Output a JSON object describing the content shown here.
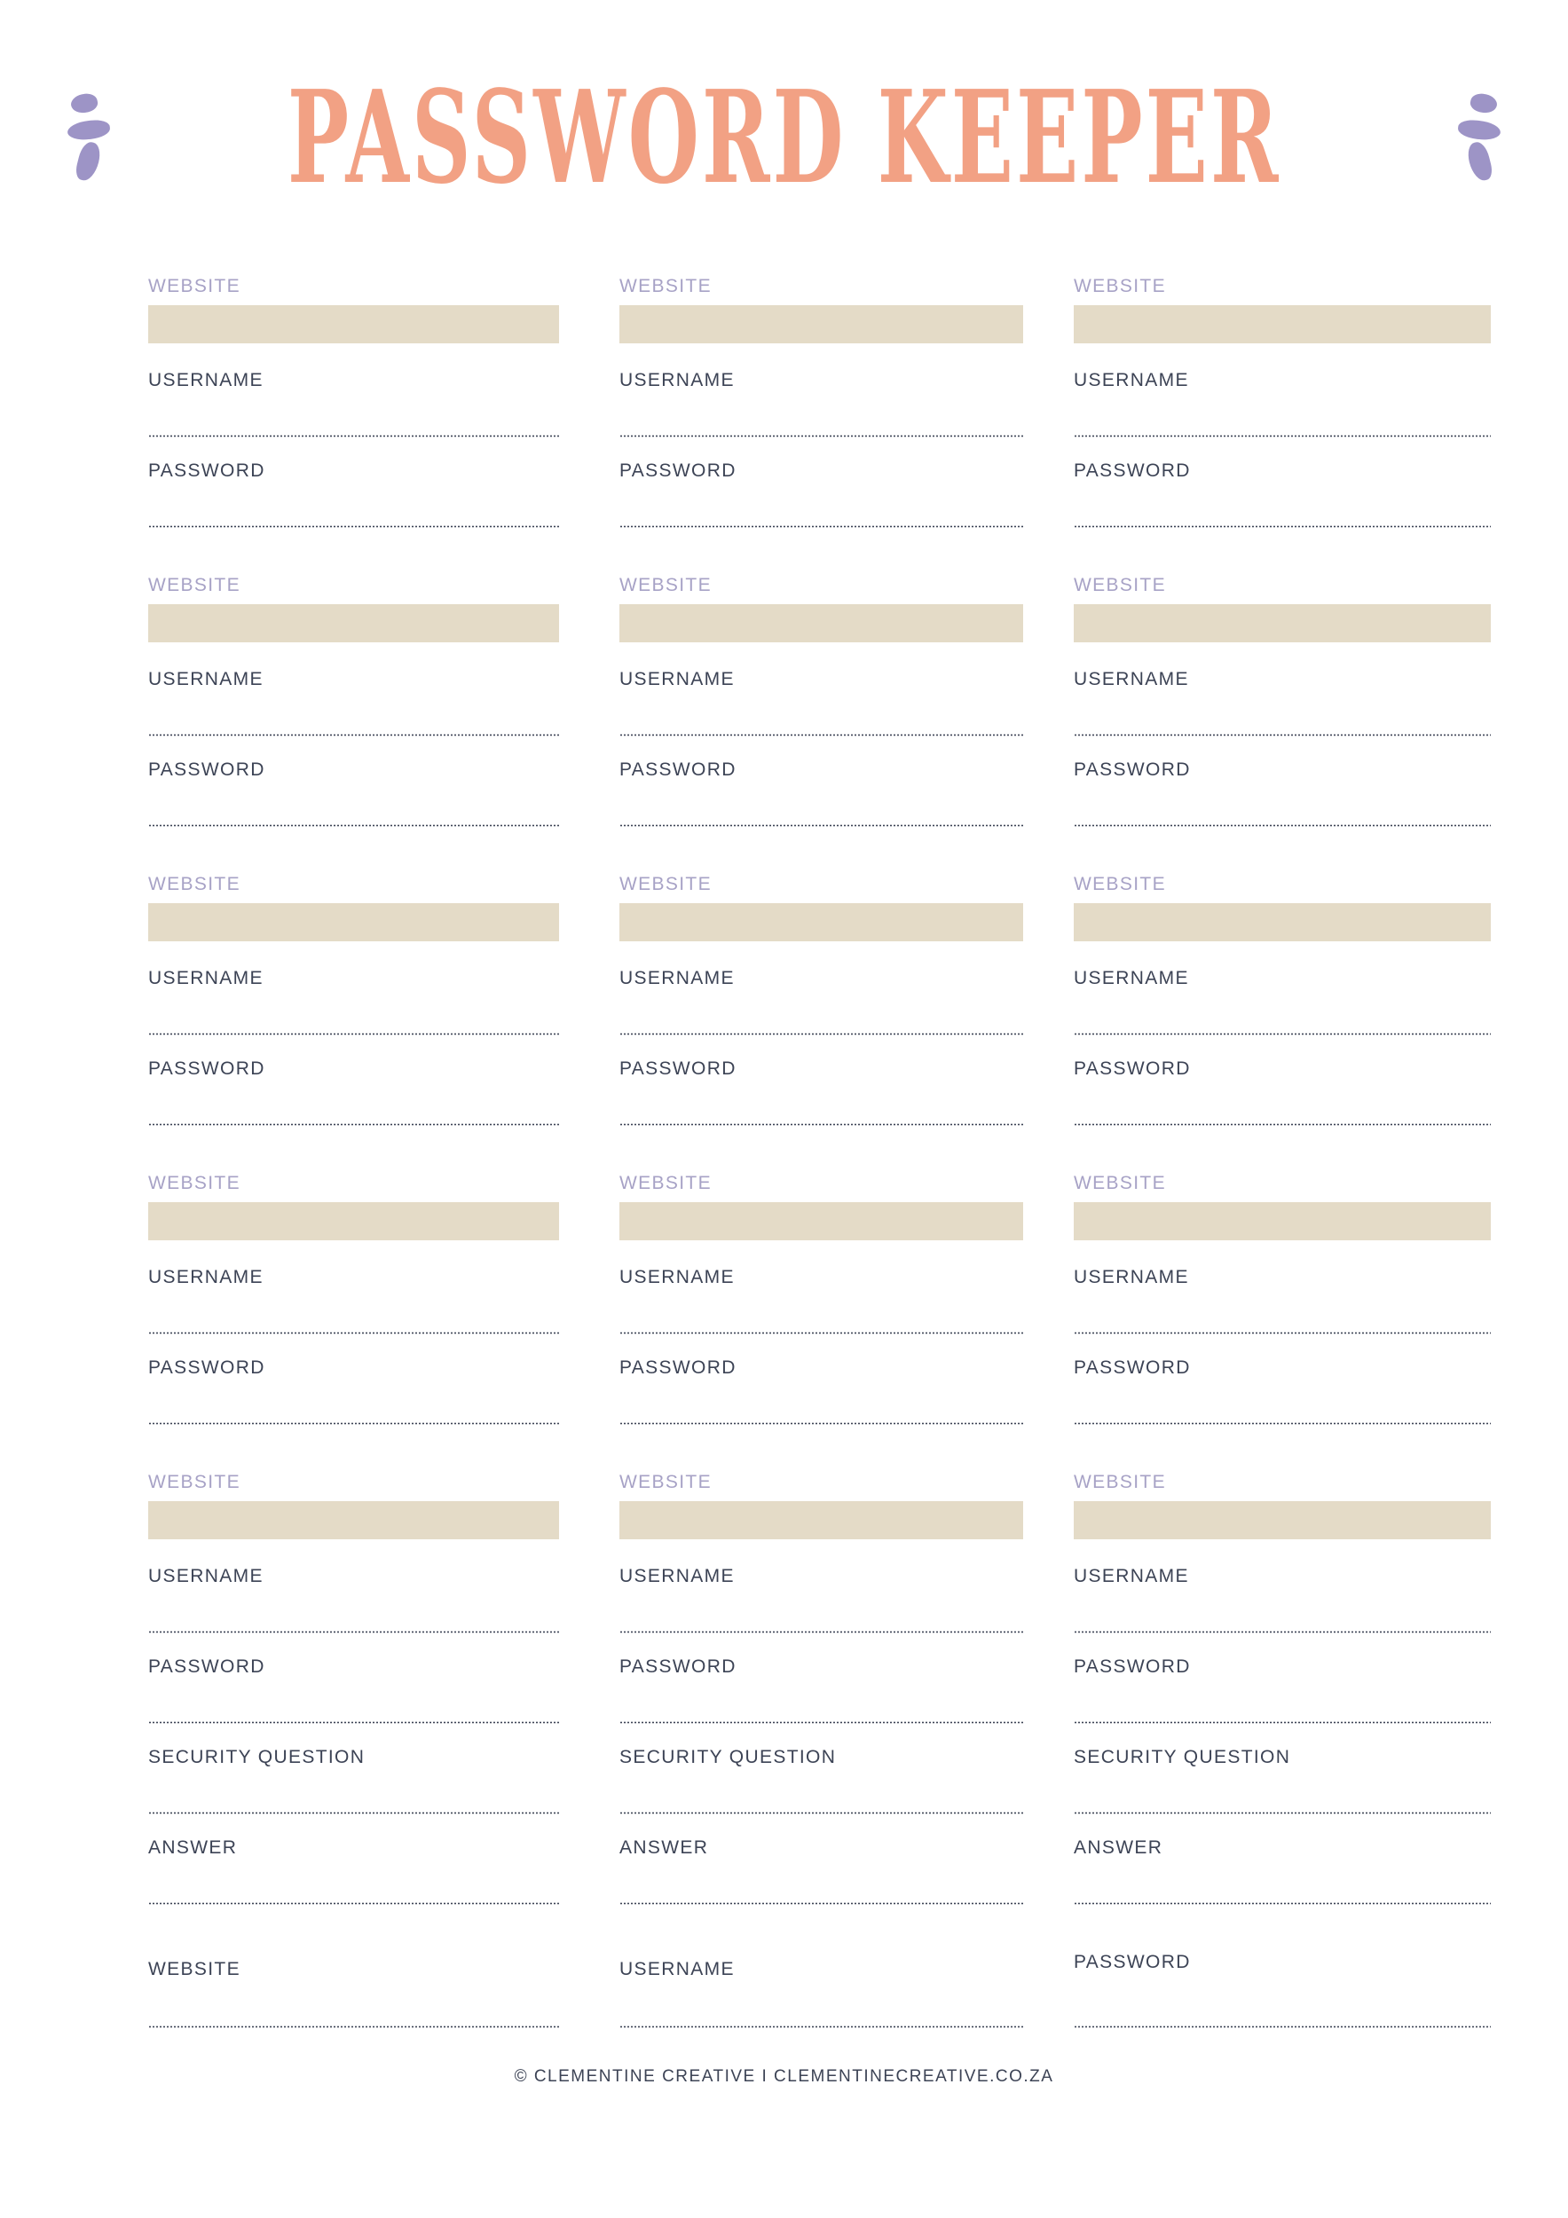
{
  "page": {
    "title": "PASSWORD KEEPER",
    "ornament_left": "leaf-ornament-left",
    "ornament_right": "leaf-ornament-right"
  },
  "colors": {
    "title": "#F2A184",
    "ornament": "#9D94C6",
    "website_label": "#A7A2C6",
    "field_label": "#3C4355",
    "fill_box": "#E4DBC7",
    "dotted_line": "#3C4355",
    "background": "#FFFFFF"
  },
  "labels": {
    "website": "WEBSITE",
    "username": "USERNAME",
    "password": "PASSWORD",
    "security_question": "SECURITY QUESTION",
    "answer": "ANSWER"
  },
  "groups": [
    {
      "id": 1,
      "columns": [
        {
          "website": "WEBSITE",
          "username": "USERNAME",
          "password": "PASSWORD"
        },
        {
          "website": "WEBSITE",
          "username": "USERNAME",
          "password": "PASSWORD"
        },
        {
          "website": "WEBSITE",
          "username": "USERNAME",
          "password": "PASSWORD"
        }
      ]
    },
    {
      "id": 2,
      "columns": [
        {
          "website": "WEBSITE",
          "username": "USERNAME",
          "password": "PASSWORD"
        },
        {
          "website": "WEBSITE",
          "username": "USERNAME",
          "password": "PASSWORD"
        },
        {
          "website": "WEBSITE",
          "username": "USERNAME",
          "password": "PASSWORD"
        }
      ]
    },
    {
      "id": 3,
      "columns": [
        {
          "website": "WEBSITE",
          "username": "USERNAME",
          "password": "PASSWORD"
        },
        {
          "website": "WEBSITE",
          "username": "USERNAME",
          "password": "PASSWORD"
        },
        {
          "website": "WEBSITE",
          "username": "USERNAME",
          "password": "PASSWORD"
        }
      ]
    },
    {
      "id": 4,
      "columns": [
        {
          "website": "WEBSITE",
          "username": "USERNAME",
          "password": "PASSWORD"
        },
        {
          "website": "WEBSITE",
          "username": "USERNAME",
          "password": "PASSWORD"
        },
        {
          "website": "WEBSITE",
          "username": "USERNAME",
          "password": "PASSWORD"
        }
      ]
    },
    {
      "id": 5,
      "columns": [
        {
          "website": "WEBSITE",
          "username": "USERNAME",
          "password": "PASSWORD",
          "security_question": "SECURITY QUESTION",
          "answer": "ANSWER"
        },
        {
          "website": "WEBSITE",
          "username": "USERNAME",
          "password": "PASSWORD",
          "security_question": "SECURITY QUESTION",
          "answer": "ANSWER"
        },
        {
          "website": "WEBSITE",
          "username": "USERNAME",
          "password": "PASSWORD",
          "security_question": "SECURITY QUESTION",
          "answer": "ANSWER"
        }
      ]
    }
  ],
  "tail_row": {
    "col1": "WEBSITE",
    "col2": "USERNAME",
    "col3": "PASSWORD"
  },
  "footer": {
    "text": "© CLEMENTINE CREATIVE I CLEMENTINECREATIVE.CO.ZA"
  }
}
